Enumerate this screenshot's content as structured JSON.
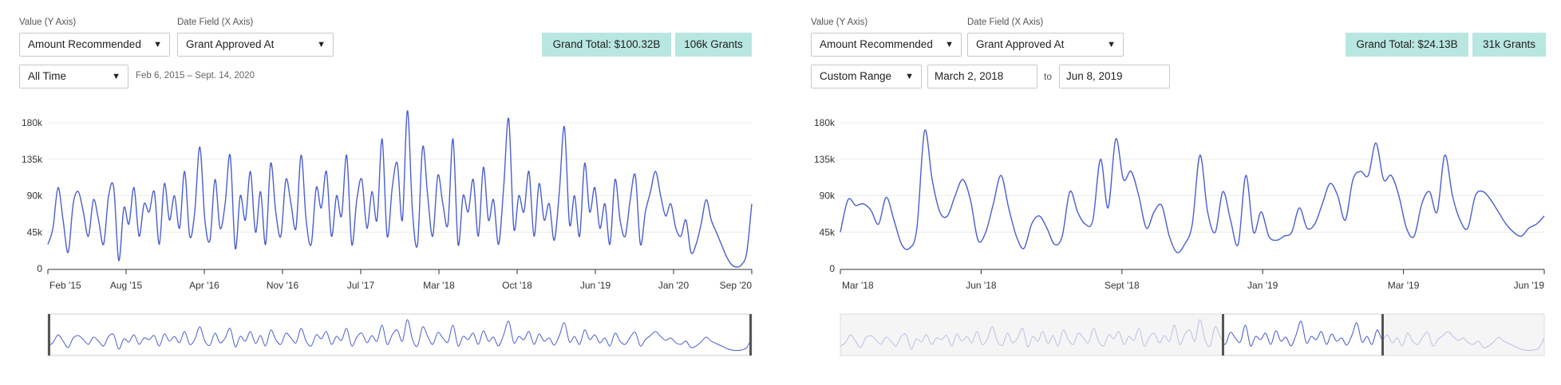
{
  "left": {
    "value_label": "Value (Y Axis)",
    "value_selected": "Amount Recommended",
    "date_label": "Date Field (X Axis)",
    "date_selected": "Grant Approved At",
    "range_selected": "All Time",
    "range_text": "Feb 6, 2015 – Sept. 14, 2020",
    "grand_total_label": "Grand Total:",
    "grand_total_value": "$100.32B",
    "grants_count": "106k Grants"
  },
  "right": {
    "value_label": "Value (Y Axis)",
    "value_selected": "Amount Recommended",
    "date_label": "Date Field (X Axis)",
    "date_selected": "Grant Approved At",
    "range_selected": "Custom Range",
    "start_date": "March 2, 2018",
    "to_label": "to",
    "end_date": "Jun 8, 2019",
    "grand_total_label": "Grand Total:",
    "grand_total_value": "$24.13B",
    "grants_count": "31k Grants"
  },
  "colors": {
    "line": "#4a5fcf",
    "badge": "#b8e6e0",
    "grid": "#ececec",
    "axis": "#333333"
  },
  "icons": {
    "caret": "caret-down-icon"
  },
  "chart_data": [
    {
      "type": "line",
      "title": "",
      "xlabel": "",
      "ylabel": "",
      "y_ticks": [
        "0",
        "45k",
        "90k",
        "135k",
        "180k"
      ],
      "ylim": [
        0,
        180000
      ],
      "x_ticks": [
        "Feb '15",
        "Aug '15",
        "Apr '16",
        "Nov '16",
        "Jul '17",
        "Mar '18",
        "Oct '18",
        "Jun '19",
        "Jan '20",
        "Sep '20"
      ],
      "grid": true,
      "series": [
        {
          "values": [
            30000,
            50000,
            100000,
            60000,
            20000,
            80000,
            95000,
            70000,
            40000,
            85000,
            60000,
            30000,
            90000,
            100000,
            10000,
            75000,
            55000,
            100000,
            40000,
            80000,
            70000,
            95000,
            30000,
            105000,
            60000,
            90000,
            50000,
            120000,
            40000,
            70000,
            150000,
            60000,
            35000,
            110000,
            50000,
            80000,
            140000,
            25000,
            90000,
            60000,
            120000,
            45000,
            95000,
            30000,
            130000,
            70000,
            40000,
            110000,
            80000,
            50000,
            140000,
            60000,
            30000,
            100000,
            75000,
            120000,
            40000,
            90000,
            65000,
            140000,
            30000,
            85000,
            110000,
            50000,
            95000,
            60000,
            160000,
            40000,
            100000,
            130000,
            60000,
            195000,
            70000,
            30000,
            150000,
            90000,
            40000,
            115000,
            80000,
            55000,
            160000,
            30000,
            90000,
            70000,
            110000,
            40000,
            125000,
            60000,
            85000,
            30000,
            100000,
            185000,
            50000,
            90000,
            70000,
            120000,
            40000,
            105000,
            60000,
            80000,
            35000,
            95000,
            175000,
            55000,
            90000,
            40000,
            130000,
            70000,
            100000,
            50000,
            80000,
            30000,
            110000,
            60000,
            40000,
            85000,
            115000,
            30000,
            70000,
            95000,
            120000,
            90000,
            65000,
            80000,
            50000,
            40000,
            60000,
            20000,
            30000,
            55000,
            85000,
            60000,
            45000,
            30000,
            15000,
            5000,
            2000,
            5000,
            20000,
            80000
          ]
        }
      ]
    },
    {
      "type": "line",
      "title": "",
      "xlabel": "",
      "ylabel": "",
      "y_ticks": [
        "0",
        "45k",
        "90k",
        "135k",
        "180k"
      ],
      "ylim": [
        0,
        180000
      ],
      "x_ticks": [
        "Mar '18",
        "Jun '18",
        "Sept '18",
        "Jan '19",
        "Mar '19",
        "Jun '19"
      ],
      "grid": true,
      "series": [
        {
          "values": [
            45000,
            85000,
            78000,
            80000,
            72000,
            55000,
            88000,
            60000,
            30000,
            25000,
            50000,
            170000,
            110000,
            70000,
            65000,
            90000,
            110000,
            85000,
            35000,
            45000,
            80000,
            115000,
            75000,
            40000,
            25000,
            55000,
            65000,
            50000,
            30000,
            40000,
            95000,
            70000,
            55000,
            60000,
            135000,
            75000,
            160000,
            110000,
            120000,
            90000,
            50000,
            70000,
            78000,
            40000,
            20000,
            30000,
            55000,
            140000,
            70000,
            45000,
            95000,
            60000,
            30000,
            115000,
            45000,
            70000,
            40000,
            35000,
            40000,
            45000,
            75000,
            50000,
            55000,
            80000,
            105000,
            90000,
            60000,
            110000,
            120000,
            115000,
            155000,
            110000,
            115000,
            90000,
            50000,
            40000,
            80000,
            95000,
            70000,
            140000,
            90000,
            60000,
            50000,
            90000,
            95000,
            85000,
            70000,
            55000,
            45000,
            40000,
            50000,
            55000,
            65000
          ]
        }
      ]
    }
  ]
}
